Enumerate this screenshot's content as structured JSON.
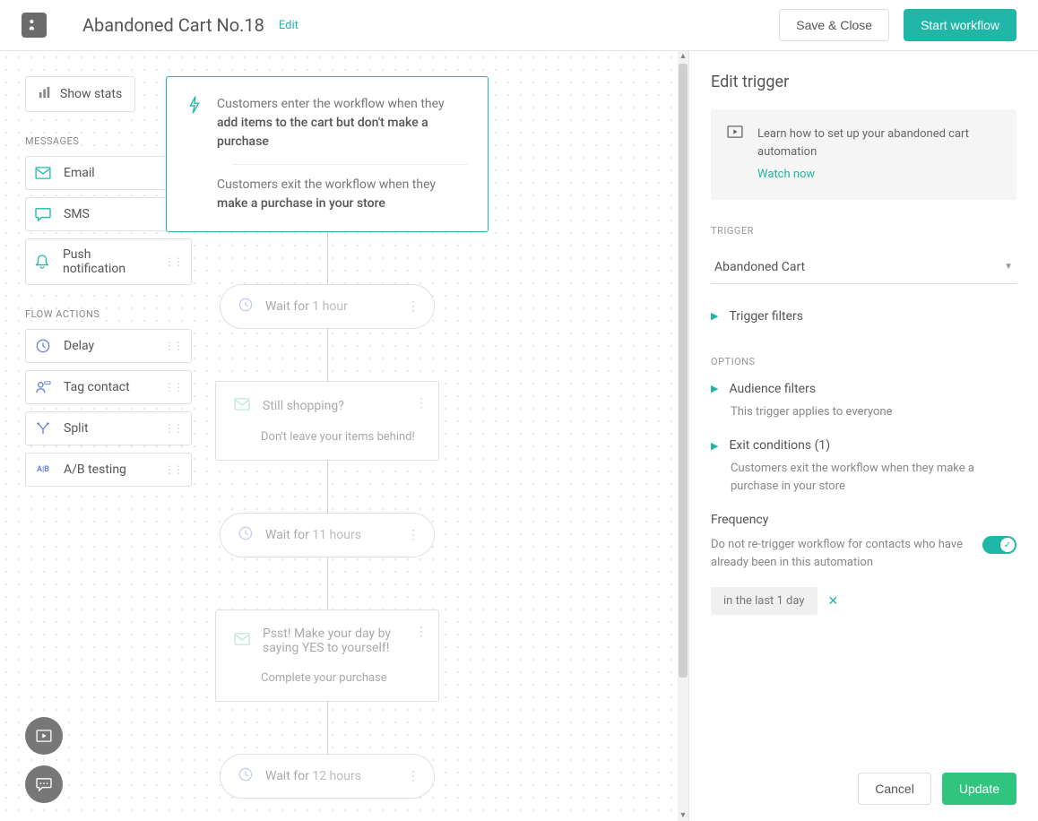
{
  "header": {
    "title": "Abandoned Cart No.18",
    "edit": "Edit",
    "save_close": "Save & Close",
    "start": "Start workflow"
  },
  "sidebar": {
    "show_stats": "Show stats",
    "messages_label": "MESSAGES",
    "messages": [
      {
        "label": "Email",
        "icon": "email"
      },
      {
        "label": "SMS",
        "icon": "sms"
      },
      {
        "label": "Push notification",
        "icon": "push"
      }
    ],
    "actions_label": "FLOW ACTIONS",
    "actions": [
      {
        "label": "Delay",
        "icon": "clock"
      },
      {
        "label": "Tag contact",
        "icon": "tag"
      },
      {
        "label": "Split",
        "icon": "split"
      },
      {
        "label": "A/B testing",
        "icon": "ab"
      }
    ]
  },
  "flow": {
    "trigger_enter_prefix": "Customers enter the workflow when they ",
    "trigger_enter_bold": "add items to the cart but don't make a purchase",
    "trigger_exit_prefix": "Customers exit the workflow when they ",
    "trigger_exit_bold": "make a purchase in your store",
    "wait1_prefix": "Wait for ",
    "wait1_value": "1 hour",
    "email1_subject": "Still shopping?",
    "email1_preview": "Don't leave your items behind!",
    "wait2_prefix": "Wait for ",
    "wait2_value": "11 hours",
    "email2_subject": "Psst! Make your day by saying YES to yourself!",
    "email2_preview": "Complete your purchase",
    "wait3_prefix": "Wait for ",
    "wait3_value": "12 hours"
  },
  "panel": {
    "title": "Edit trigger",
    "info_text": "Learn how to set up your abandoned cart automation",
    "watch": "Watch now",
    "trigger_label": "TRIGGER",
    "trigger_value": "Abandoned Cart",
    "trigger_filters": "Trigger filters",
    "options_label": "OPTIONS",
    "audience_filters": "Audience filters",
    "audience_sub": "This trigger applies to everyone",
    "exit_cond": "Exit conditions (1)",
    "exit_sub": "Customers exit the workflow when they make a purchase in your store",
    "freq_title": "Frequency",
    "freq_text": "Do not re-trigger workflow for contacts who have already been in this automation",
    "chip": "in the last 1 day",
    "cancel": "Cancel",
    "update": "Update"
  }
}
